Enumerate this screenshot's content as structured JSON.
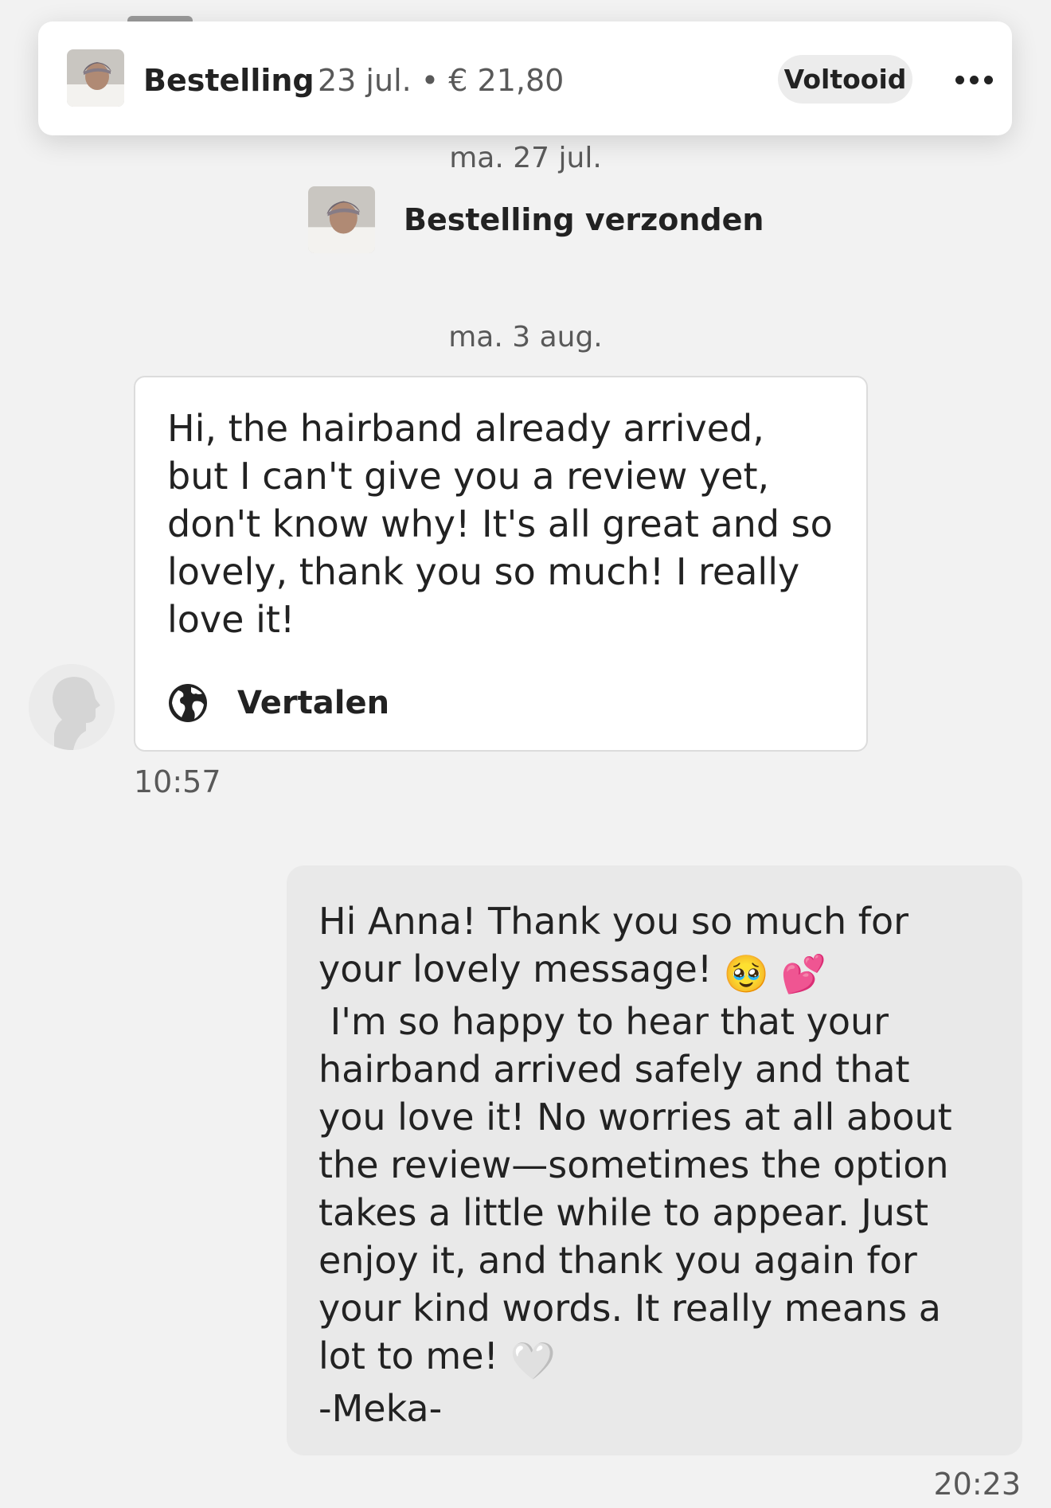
{
  "order": {
    "title": "Bestelling",
    "meta": "23 jul. • € 21,80",
    "status": "Voltooid"
  },
  "conversation": {
    "date_1": "ma. 27 jul.",
    "event_shipped": "Bestelling verzonden",
    "date_2": "ma. 3 aug."
  },
  "incoming_message": {
    "text": "Hi, the hairband already arrived,\nbut I can't give you a review yet,\ndon't know why! It's all great and so\nlovely, thank you so much! I really\nlove it!",
    "translate_label": "Vertalen",
    "time": "10:57"
  },
  "outgoing_message": {
    "text_line_1": "Hi Anna! Thank you so much for",
    "text_line_2": "your lovely message! ",
    "emoji_1": "🥹",
    "emoji_2": "💕",
    "text_rest": " I'm so happy to hear that your\nhairband arrived safely and that\nyou love it! No worries at all about\nthe review—sometimes the option\ntakes a little while to appear. Just\nenjoy it, and thank you again for\nyour kind words. It really means a\nlot to me! ",
    "emoji_3": "🤍",
    "signature": "-Meka-",
    "time": "20:23"
  },
  "icons": {
    "more": "more-horizontal-icon",
    "translate": "globe-icon",
    "avatar": "default-user-avatar-icon"
  },
  "colors": {
    "background": "#f2f2f2",
    "incoming_bubble": "#ffffff",
    "outgoing_bubble": "#e9e9e9",
    "status_badge": "#ececec"
  }
}
